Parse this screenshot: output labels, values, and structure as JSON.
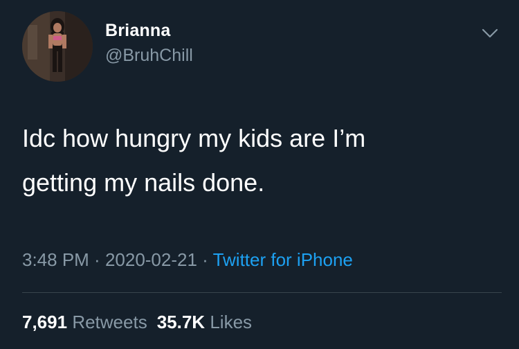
{
  "user": {
    "display_name": "Brianna",
    "handle": "@BruhChill"
  },
  "tweet": {
    "text_line1": "Idc how hungry my kids are I’m",
    "text_line2": "getting my nails done."
  },
  "meta": {
    "time": "3:48 PM",
    "separator": " · ",
    "date": "2020-02-21",
    "source": "Twitter for iPhone"
  },
  "stats": {
    "retweets_count": "7,691",
    "retweets_label": "Retweets",
    "likes_count": "35.7K",
    "likes_label": "Likes"
  },
  "icons": {
    "menu": "chevron-down-icon",
    "avatar": "profile-photo"
  },
  "colors": {
    "background": "#15202b",
    "text_primary": "#ffffff",
    "text_secondary": "#8899a6",
    "link": "#1da1f2",
    "divider": "#38444d"
  }
}
